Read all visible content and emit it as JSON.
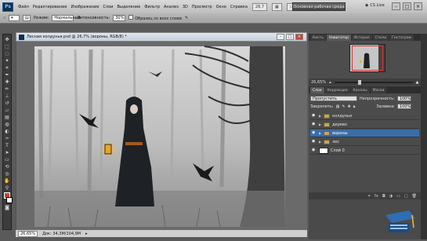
{
  "menubar": {
    "logo": "Ps",
    "mini_zoom": "26,7",
    "items": [
      "Файл",
      "Редактирование",
      "Изображение",
      "Слои",
      "Выделение",
      "Фильтр",
      "Анализ",
      "3D",
      "Просмотр",
      "Окно",
      "Справка"
    ],
    "workspace": "Основная рабочая среда",
    "cslive": "CS Live"
  },
  "options": {
    "mode_label": "Режим:",
    "mode_value": "Нормальный",
    "intensity_label": "Интенсивность:",
    "intensity_value": "30%",
    "sample_all": "Образец со всех слоев"
  },
  "document": {
    "title": "Лесная колдунья.psd @ 26,7% (вороны, RGB/8) *",
    "zoom": "26,65%",
    "doc_info": "Док: 34,3M/104,9M"
  },
  "panels": {
    "top_tabs": [
      "Кисть",
      "Навигатор",
      "История",
      "Стили",
      "Гистограм"
    ],
    "navigator_zoom": "26,65%",
    "layer_tabs": [
      "Слои",
      "Коррекция",
      "Каналы",
      "Маски"
    ],
    "blend_mode": "Пропустить",
    "opacity_label": "Непрозрачность:",
    "opacity_value": "100%",
    "lock_label": "Закрепить:",
    "fill_label": "Заливка:",
    "fill_value": "100%",
    "layers": [
      {
        "name": "колдунья",
        "selected": false,
        "type": "group"
      },
      {
        "name": "дерево",
        "selected": false,
        "type": "group"
      },
      {
        "name": "вороны",
        "selected": true,
        "type": "group"
      },
      {
        "name": "лес",
        "selected": false,
        "type": "group"
      },
      {
        "name": "Слой 0",
        "selected": false,
        "type": "layer"
      }
    ]
  },
  "colors": {
    "selection": "#3a6ea8",
    "foreground": "#c04a2c",
    "background": "#ffffff"
  }
}
